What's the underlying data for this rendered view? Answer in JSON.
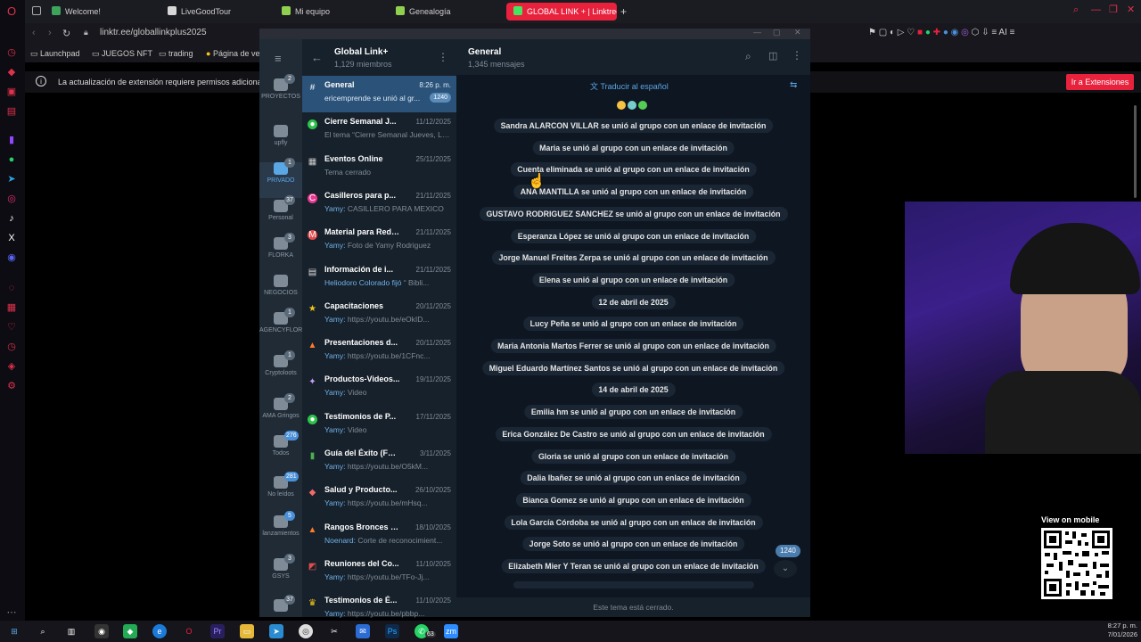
{
  "browser": {
    "tabs": [
      {
        "label": "Welcome!",
        "color": "#3ea35b"
      },
      {
        "label": "LiveGoodTour",
        "color": "#d7d7d7"
      },
      {
        "label": "Mi equipo",
        "color": "#8fd14f"
      },
      {
        "label": "Genealogía",
        "color": "#8fd14f"
      },
      {
        "label": "GLOBAL LINK + | Linktree",
        "color": "#43e660"
      }
    ],
    "new_tab": "+",
    "url": "linktr.ee/globallinkplus2025",
    "bookmarks": [
      "Launchpad",
      "JUEGOS NFT",
      "trading",
      "Página de ve"
    ],
    "notice": "La actualización de extensión requiere permisos adicionales",
    "notice_button": "Ir a Extensiones",
    "accent": "#e8213d",
    "toolbar_ai": "AI"
  },
  "folders": [
    {
      "label": "PROYECTOS",
      "badge": "2"
    },
    {
      "label": "upfly",
      "badge": ""
    },
    {
      "label": "PRIVADO",
      "badge": "1"
    },
    {
      "label": "Personal",
      "badge": "37"
    },
    {
      "label": "FLORKA",
      "badge": "3"
    },
    {
      "label": "NEGOCIOS",
      "badge": ""
    },
    {
      "label": "AGENCYFLORKA",
      "badge": "1"
    },
    {
      "label": "Cryptoloots",
      "badge": "1"
    },
    {
      "label": "AMA Gringos",
      "badge": "2"
    },
    {
      "label": "Todos",
      "badge": "276"
    },
    {
      "label": "No leídos",
      "badge": "281"
    },
    {
      "label": "lanzamientos",
      "badge": "5"
    },
    {
      "label": "GSYS",
      "badge": "3"
    },
    {
      "label": "",
      "badge": "37"
    }
  ],
  "group": {
    "name": "Global Link+",
    "members": "1,129 miembros"
  },
  "topics": [
    {
      "icon": "hash",
      "name": "General",
      "date": "8:26 p. m.",
      "preview": "ericemprende se unió al gr...",
      "badge": "1240",
      "who": ""
    },
    {
      "icon": "speech",
      "name": "Cierre Semanal J...",
      "date": "11/12/2025",
      "preview": "El tema “Cierre Semanal Jueves, Le...",
      "who": "",
      "badge": ""
    },
    {
      "icon": "calendar",
      "name": "Eventos Online",
      "date": "25/11/2025",
      "preview": "Tema cerrado",
      "who": "",
      "badge": ""
    },
    {
      "icon": "C",
      "name": "Casilleros para p...",
      "date": "21/11/2025",
      "who": "Yamy:",
      "preview": "CASILLERO PARA MEXICO",
      "badge": ""
    },
    {
      "icon": "M",
      "name": "Material para Redes...",
      "date": "21/11/2025",
      "who": "Yamy:",
      "preview": "Foto de Yamy Rodriguez",
      "badge": ""
    },
    {
      "icon": "doc",
      "name": "Información de i...",
      "date": "21/11/2025",
      "who": "Heliodoro Colorado fijó",
      "preview": "“ Bibli...",
      "badge": ""
    },
    {
      "icon": "star",
      "name": "Capacitaciones",
      "date": "20/11/2025",
      "who": "Yamy:",
      "preview": "https://youtu.be/eOkID...",
      "badge": ""
    },
    {
      "icon": "fire",
      "name": "Presentaciones d...",
      "date": "20/11/2025",
      "who": "Yamy:",
      "preview": "https://youtu.be/1CFnc...",
      "badge": ""
    },
    {
      "icon": "sparkle",
      "name": "Productos-Videos...",
      "date": "19/11/2025",
      "who": "Yamy:",
      "preview": "Video",
      "badge": ""
    },
    {
      "icon": "speech",
      "name": "Testimonios de P...",
      "date": "17/11/2025",
      "who": "Yamy:",
      "preview": "Video",
      "badge": ""
    },
    {
      "icon": "book",
      "name": "Guía del Éxito (For...",
      "date": "3/11/2025",
      "who": "Yamy:",
      "preview": "https://youtu.be/O5kM...",
      "badge": ""
    },
    {
      "icon": "pill",
      "name": "Salud y Producto...",
      "date": "26/10/2025",
      "who": "Yamy:",
      "preview": "https://youtu.be/mHsq...",
      "badge": ""
    },
    {
      "icon": "fire",
      "name": "Rangos Bronces y...",
      "date": "18/10/2025",
      "who": "Noenard:",
      "preview": "Corte de reconocimient...",
      "badge": ""
    },
    {
      "icon": "chart",
      "name": "Reuniones del Co...",
      "date": "11/10/2025",
      "who": "Yamy:",
      "preview": "https://youtu.be/TFo-Jj...",
      "badge": ""
    },
    {
      "icon": "trophy",
      "name": "Testimonios de É...",
      "date": "11/10/2025",
      "who": "Yamy:",
      "preview": "https://youtu.be/pbbp...",
      "badge": ""
    }
  ],
  "chat": {
    "title": "General",
    "subtitle": "1,345 mensajes",
    "translate": "Traducir al español",
    "messages": [
      "Sandra ALARCON VILLAR se unió al grupo con un enlace de invitación",
      "Maria se unió al grupo con un enlace de invitación",
      "Cuenta eliminada se unió al grupo con un enlace de invitación",
      "ANA MANTILLA se unió al grupo con un enlace de invitación",
      "GUSTAVO RODRIGUEZ SANCHEZ se unió al grupo con un enlace de invitación",
      "Esperanza López se unió al grupo con un enlace de invitación",
      "Jorge Manuel Freites Zerpa se unió al grupo con un enlace de invitación",
      "Elena se unió al grupo con un enlace de invitación",
      "12 de abril de 2025",
      "Lucy Peña se unió al grupo con un enlace de invitación",
      "Maria Antonia Martos Ferrer se unió al grupo con un enlace de invitación",
      "Miguel Eduardo Martínez Santos se unió al grupo con un enlace de invitación",
      "14 de abril de 2025",
      "Emilia hm se unió al grupo con un enlace de invitación",
      "Erica González De Castro se unió al grupo con un enlace de invitación",
      "Gloria se unió al grupo con un enlace de invitación",
      "Dalia Ibañez se unió al grupo con un enlace de invitación",
      "Bianca Gomez se unió al grupo con un enlace de invitación",
      "Lola García Córdoba se unió al grupo con un enlace de invitación",
      "Jorge Soto se unió al grupo con un enlace de invitación",
      "Elizabeth Mier Y Teran se unió al grupo con un enlace de invitación"
    ],
    "unread_badge": "1240",
    "footer": "Este tema está cerrado."
  },
  "overlay": {
    "qr_title": "View on mobile"
  },
  "taskbar": {
    "whatsapp_badge": "63",
    "time": "8:27 p. m.",
    "date": "7/01/2026"
  }
}
